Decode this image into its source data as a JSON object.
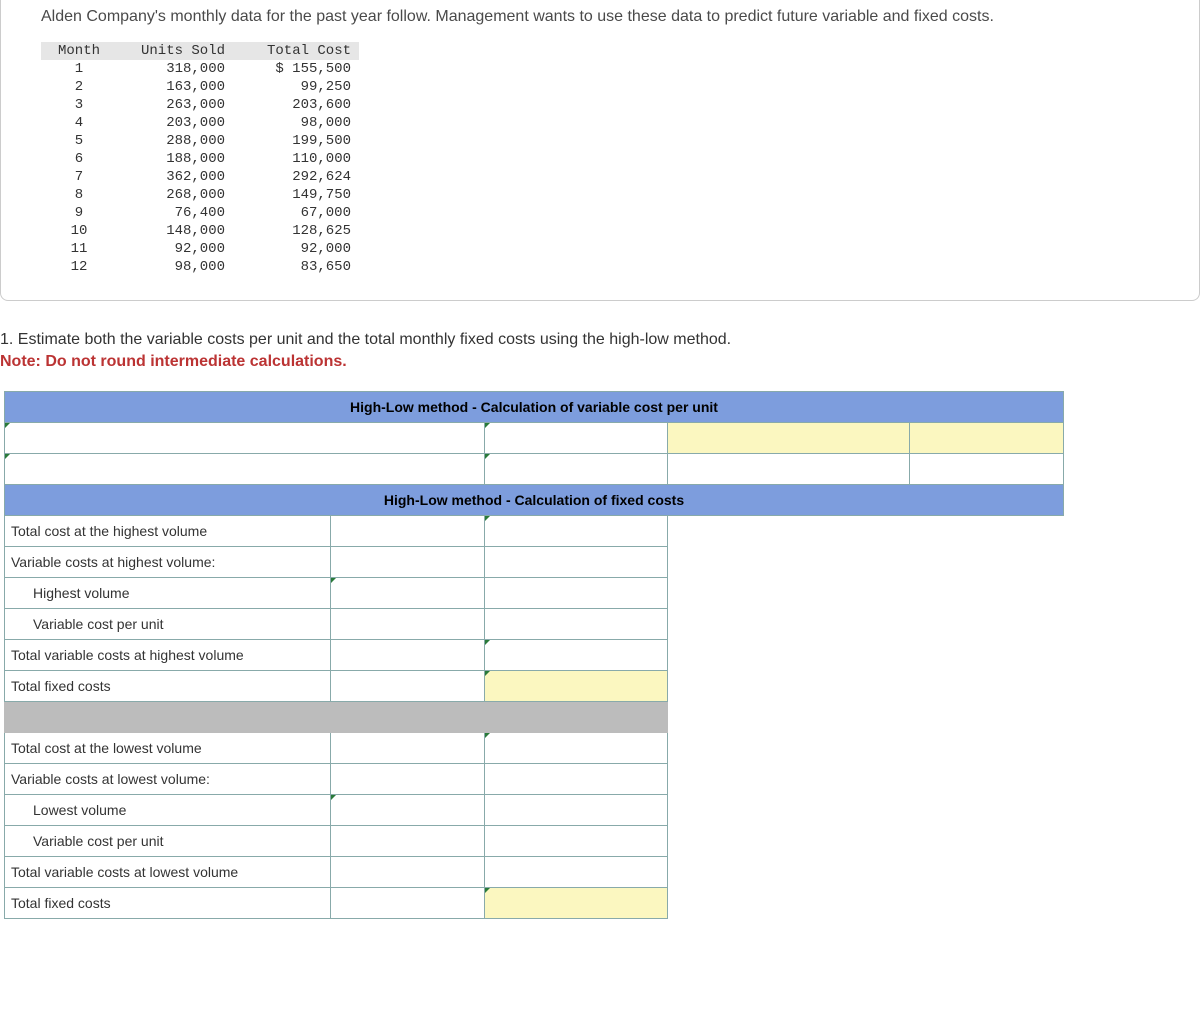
{
  "intro": "Alden Company's monthly data for the past year follow. Management wants to use these data to predict future variable and fixed costs.",
  "headers": {
    "month": "Month",
    "units": "Units Sold",
    "cost": "Total Cost"
  },
  "rows": [
    {
      "m": "1",
      "u": "318,000",
      "c": "$ 155,500"
    },
    {
      "m": "2",
      "u": "163,000",
      "c": "99,250"
    },
    {
      "m": "3",
      "u": "263,000",
      "c": "203,600"
    },
    {
      "m": "4",
      "u": "203,000",
      "c": "98,000"
    },
    {
      "m": "5",
      "u": "288,000",
      "c": "199,500"
    },
    {
      "m": "6",
      "u": "188,000",
      "c": "110,000"
    },
    {
      "m": "7",
      "u": "362,000",
      "c": "292,624"
    },
    {
      "m": "8",
      "u": "268,000",
      "c": "149,750"
    },
    {
      "m": "9",
      "u": "76,400",
      "c": "67,000"
    },
    {
      "m": "10",
      "u": "148,000",
      "c": "128,625"
    },
    {
      "m": "11",
      "u": "92,000",
      "c": "92,000"
    },
    {
      "m": "12",
      "u": "98,000",
      "c": "83,650"
    }
  ],
  "q_prefix": "1. ",
  "q_text": "Estimate both the variable costs per unit and the total monthly fixed costs using the high-low method.",
  "note": "Note: Do not round intermediate calculations.",
  "ws": {
    "header1": "High-Low method - Calculation of variable cost per unit",
    "header2": "High-Low method - Calculation of fixed costs",
    "l_totalHigh": "Total cost at the highest volume",
    "l_varHigh": "Variable costs at highest volume:",
    "l_highVol": "Highest volume",
    "l_vcpu": "Variable cost per unit",
    "l_tvcHigh": "Total variable costs at highest volume",
    "l_fixed": "Total fixed costs",
    "l_totalLow": "Total cost at the lowest volume",
    "l_varLow": "Variable costs at lowest volume:",
    "l_lowVol": "Lowest volume",
    "l_tvcLow": "Total variable costs at lowest volume"
  }
}
